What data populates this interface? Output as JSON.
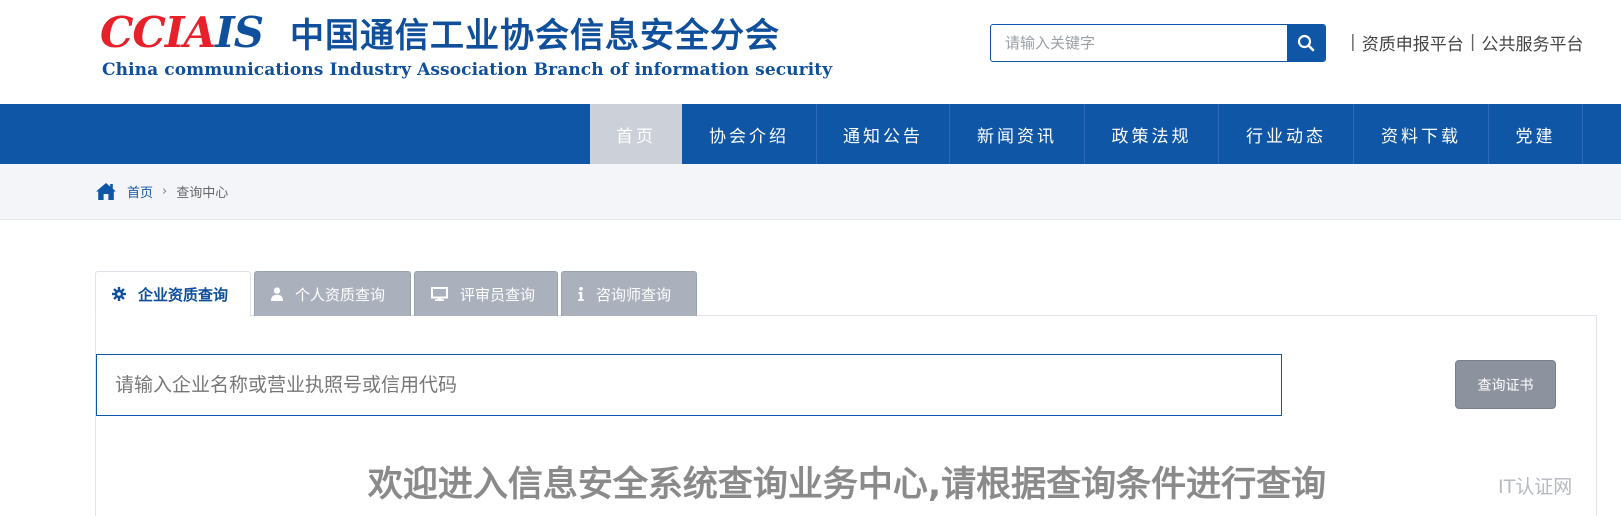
{
  "logo": {
    "mark_red": "CCIA",
    "mark_blue": "IS",
    "name_cn": "中国通信工业协会信息安全分会",
    "name_en": "China communications Industry Association Branch of information security"
  },
  "search": {
    "placeholder": "请输入关键字",
    "button_icon": "search-icon"
  },
  "top_links": {
    "separator": "|",
    "items": [
      "资质申报平台",
      "公共服务平台"
    ]
  },
  "nav": {
    "items": [
      {
        "label": "首页",
        "active": true
      },
      {
        "label": "协会介绍",
        "active": false
      },
      {
        "label": "通知公告",
        "active": false
      },
      {
        "label": "新闻资讯",
        "active": false
      },
      {
        "label": "政策法规",
        "active": false
      },
      {
        "label": "行业动态",
        "active": false
      },
      {
        "label": "资料下载",
        "active": false
      },
      {
        "label": "党建",
        "active": false
      }
    ]
  },
  "breadcrumb": {
    "icon": "home-icon",
    "home": "首页",
    "separator": "›",
    "current": "查询中心"
  },
  "tabs": [
    {
      "label": "企业资质查询",
      "icon": "gear-icon",
      "active": true
    },
    {
      "label": "个人资质查询",
      "icon": "user-icon",
      "active": false
    },
    {
      "label": "评审员查询",
      "icon": "monitor-icon",
      "active": false
    },
    {
      "label": "咨询师查询",
      "icon": "info-icon",
      "active": false
    }
  ],
  "query": {
    "placeholder": "请输入企业名称或营业执照号或信用代码",
    "button_label": "查询证书"
  },
  "welcome_text": "欢迎进入信息安全系统查询业务中心,请根据查询条件进行查询",
  "watermark": "IT认证网",
  "colors": {
    "brand_blue": "#0f56a6",
    "logo_red": "#e8202a",
    "nav_active": "#ccd0d8",
    "tab_inactive": "#aab1bd",
    "button_gray": "#8d939e"
  }
}
